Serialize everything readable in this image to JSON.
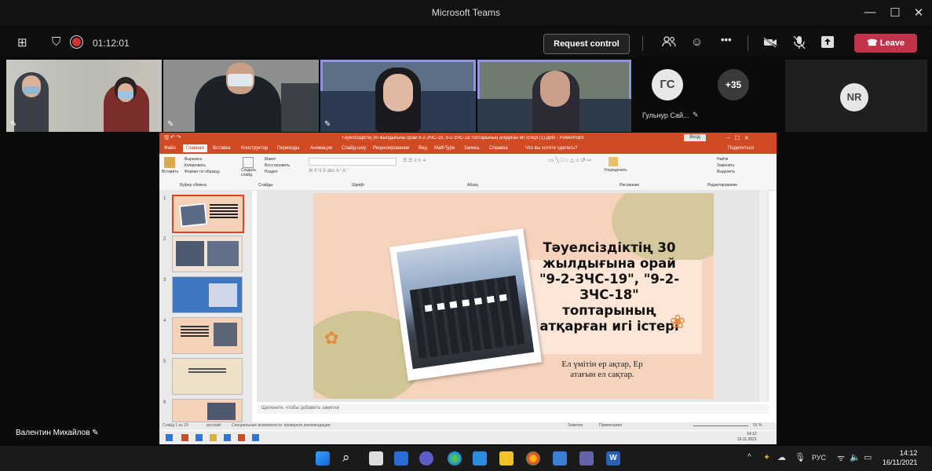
{
  "window": {
    "title": "Microsoft Teams",
    "minimize": "—",
    "maximize": "☐",
    "close": "✕"
  },
  "toolbar": {
    "timer": "01:12:01",
    "request_control": "Request control",
    "leave": "Leave",
    "more": "•••"
  },
  "participants": {
    "gs_initials": "ГС",
    "gs_name": "Гульнур Сай...",
    "overflow_count": "+35",
    "nr_initials": "NR"
  },
  "presenter": {
    "name": "Валентин Михайлов"
  },
  "powerpoint": {
    "title_text": "Тәуелсіздіктің 30 жылдығына орай 9-2-ЗЧС-19, 9-2-ЗЧС-18 топтарының атқарған игі істері (1).pptx - PowerPoint",
    "sign_in": "Вход",
    "menu": [
      "Файл",
      "Главная",
      "Вставка",
      "Конструктор",
      "Переходы",
      "Анимация",
      "Слайд-шоу",
      "Рецензирование",
      "Вид",
      "MathType",
      "Запись",
      "Справка",
      "Что вы хотите сделать?"
    ],
    "share": "Поделиться",
    "ribbon": {
      "paste": "Вставить",
      "cut": "Вырезать",
      "copy": "Копировать",
      "format_painter": "Формат по образцу",
      "clipboard": "Буфер обмена",
      "new_slide": "Создать слайд",
      "layout": "Макет",
      "reset": "Восстановить",
      "section": "Раздел",
      "slides": "Слайды",
      "font": "Шрифт",
      "paragraph": "Абзац",
      "arrange": "Упорядочить",
      "drawing": "Рисование",
      "find": "Найти",
      "replace": "Заменить",
      "select": "Выделить",
      "editing": "Редактирование"
    },
    "thumb_numbers": [
      "1",
      "2",
      "3",
      "4",
      "5",
      "6"
    ],
    "slide": {
      "title_lines": [
        "Тәуелсіздіктің 30",
        "жылдығына орай",
        "\"9-2-ЗЧС-19\", \"9-2-",
        "ЗЧС-18\"",
        "топтарының",
        "атқарған игі істері"
      ],
      "subtitle_lines": [
        "Ел үмітін ер ақтар, Ер",
        "атағын ел сақтар."
      ]
    },
    "notes_placeholder": "Щелкните, чтобы добавить заметки",
    "status_slide": "Слайд 1 из 19",
    "status_lang": "русский",
    "status_access": "Специальные возможности: проверьте рекомендации",
    "status_notes": "Заметки",
    "status_comments": "Примечания",
    "zoom": "55 %",
    "inner_time": "14:12",
    "inner_date": "16.11.2021"
  },
  "taskbar": {
    "lang": "РУС",
    "time": "14:12",
    "date": "16/11/2021"
  },
  "colors": {
    "accent_teams": "#8f93e0",
    "leave_red": "#c4314b",
    "ppt_orange": "#d04a23",
    "slide_peach": "#f6d3bd"
  }
}
